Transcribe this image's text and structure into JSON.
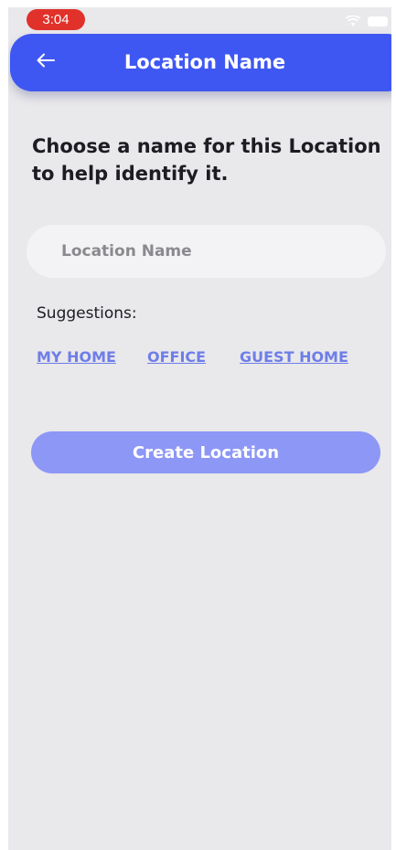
{
  "status_bar": {
    "time": "3:04",
    "wifi_icon": "wifi-icon",
    "battery_icon": "battery-icon"
  },
  "app_bar": {
    "back_icon": "arrow-left-icon",
    "title": "Location Name",
    "color": "#3f57f2"
  },
  "main": {
    "headline": "Choose a name for this Location to help identify it.",
    "input": {
      "value": "",
      "placeholder": "Location Name"
    },
    "suggestions_label": "Suggestions:",
    "suggestions": [
      "MY HOME",
      "OFFICE",
      "GUEST HOME"
    ],
    "create_button_label": "Create Location",
    "create_button_color": "#8d97f6"
  }
}
